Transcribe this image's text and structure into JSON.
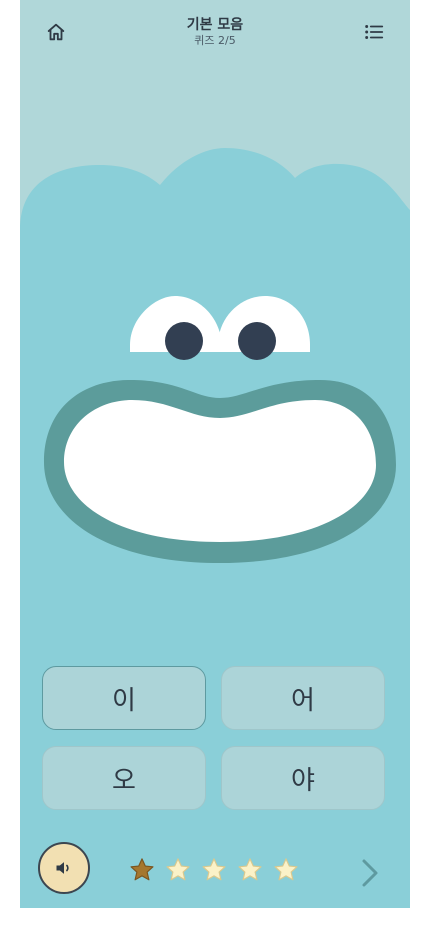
{
  "header": {
    "title": "기본 모음",
    "subtitle": "퀴즈 2/5",
    "home_icon": "home-icon",
    "menu_icon": "list-icon"
  },
  "answers": [
    {
      "label": "이",
      "selected": true
    },
    {
      "label": "어",
      "selected": false
    },
    {
      "label": "오",
      "selected": false
    },
    {
      "label": "야",
      "selected": false
    }
  ],
  "progress": {
    "stars_total": 5,
    "stars_earned": 1
  },
  "colors": {
    "background": "#8acfd8",
    "sky": "#b0d7d9",
    "mouth_outline": "#5c9c9b",
    "star_filled": "#a5772e",
    "star_empty": "#fbf2c8",
    "sound_button": "#f2e0b2"
  },
  "controls": {
    "sound_icon": "speaker-icon",
    "next_icon": "chevron-right-icon"
  }
}
